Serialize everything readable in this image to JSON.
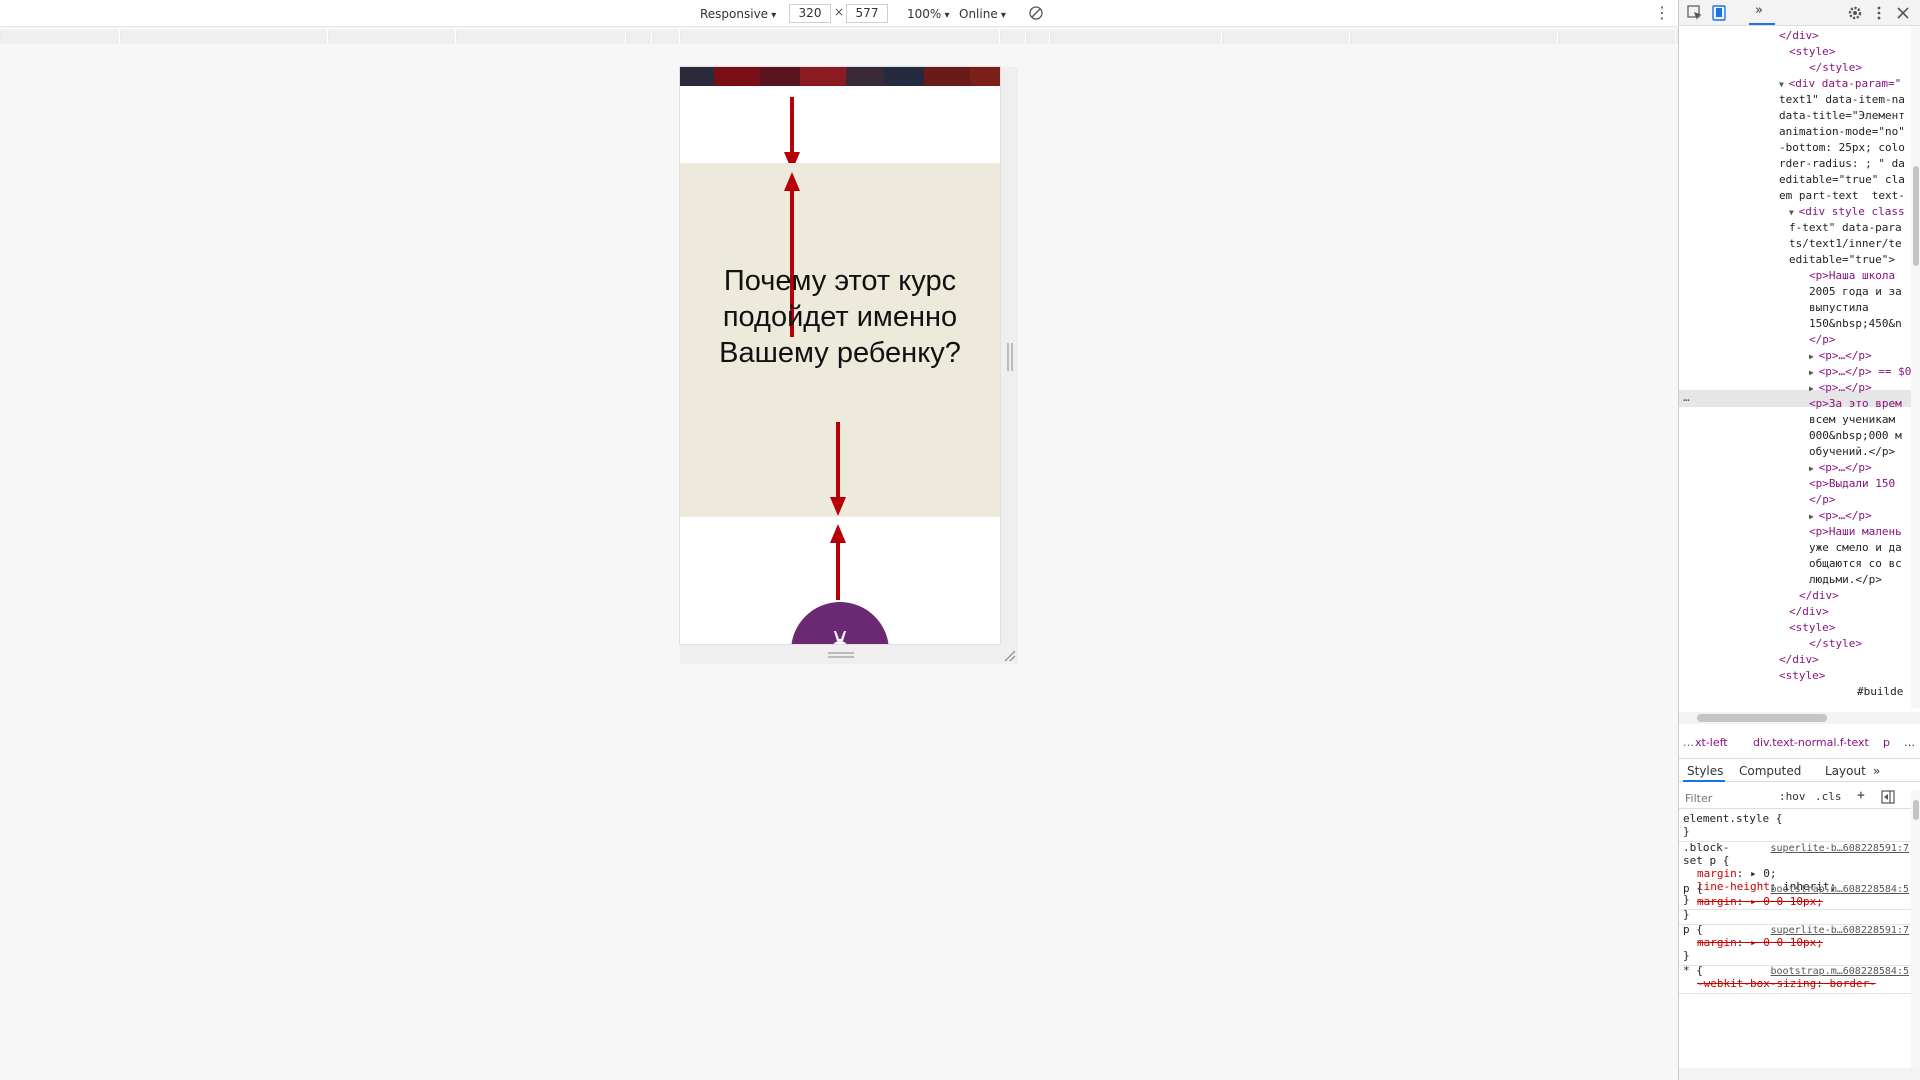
{
  "device_toolbar": {
    "device_label": "Responsive",
    "width_value": "320",
    "times_sign": "×",
    "height_value": "577",
    "zoom_label": "100%",
    "throttle_label": "Online",
    "more_glyph": "⋮"
  },
  "page": {
    "heading": "Почему этот курс подойдет именно Вашему ребенку?"
  },
  "colors": {
    "beige": "#eeeadb",
    "arrow_red": "#b50008",
    "purple": "#6b2873",
    "accent_blue": "#1a73e8"
  },
  "devtools": {
    "tab_more_glyph": "»",
    "tree_lines": [
      "</div>",
      "<style>",
      "</style>",
      "<div data-param=\"",
      "text1\" data-item-na",
      "data-title=\"Элемент",
      "animation-mode=\"no\"",
      "-bottom: 25px; colo",
      "rder-radius: ; \" da",
      "editable=\"true\" cla",
      "em part-text  text-",
      "<div style class",
      "f-text\" data-para",
      "ts/text1/inner/te",
      "editable=\"true\">",
      "<p>Наша школа",
      "2005 года и за",
      "выпустила",
      "150&nbsp;450&n",
      "</p>",
      "<p>…</p>",
      "<p>…</p> == $0",
      "<p>…</p>",
      "<p>За это врем",
      "всем ученикам",
      "000&nbsp;000 м",
      "обучений.</p>",
      "<p>…</p>",
      "<p>Выдали 150",
      "</p>",
      "<p>…</p>",
      "<p>Наши малень",
      "уже смело и да",
      "общаются со вс",
      "людьми.</p>",
      "</div>",
      "</div>",
      "<style>",
      "</style>",
      "</div>",
      "<style>",
      "#builde"
    ],
    "tree_dots": "…",
    "breadcrumb": {
      "lead": "…",
      "item1": "xt-left",
      "item2": "div.text-normal.f-text",
      "item3": "p",
      "more": "…"
    },
    "styles_tabs": {
      "styles": "Styles",
      "computed": "Computed",
      "layout": "Layout",
      "more": "»"
    },
    "filter": {
      "placeholder": "Filter",
      "hov": ":hov",
      "cls": ".cls",
      "plus": "+"
    },
    "rules": [
      {
        "selector": "element.style {",
        "source": "",
        "props": [],
        "close": "}"
      },
      {
        "selector": ".block-",
        "selector2": "set p {",
        "source": "superlite-b…608228591:7",
        "props": [
          {
            "name": "margin",
            "value": "▸ 0;",
            "struck": false
          },
          {
            "name": "line-height",
            "value": "inherit;",
            "struck": false
          }
        ],
        "close": "}"
      },
      {
        "selector": "p {",
        "source": "bootstrap.m…608228584:5",
        "props": [
          {
            "name": "margin",
            "value": "▸ 0 0 10px;",
            "struck": true
          }
        ],
        "close": "}"
      },
      {
        "selector": "p {",
        "source": "superlite-b…608228591:7",
        "props": [
          {
            "name": "margin",
            "value": "▸ 0 0 10px;",
            "struck": true
          }
        ],
        "close": "}"
      },
      {
        "selector": "* {",
        "source": "bootstrap.m…608228584:5",
        "props": [
          {
            "name": "-webkit-box-sizing",
            "value": "border-",
            "struck": true
          }
        ],
        "close": ""
      }
    ]
  }
}
